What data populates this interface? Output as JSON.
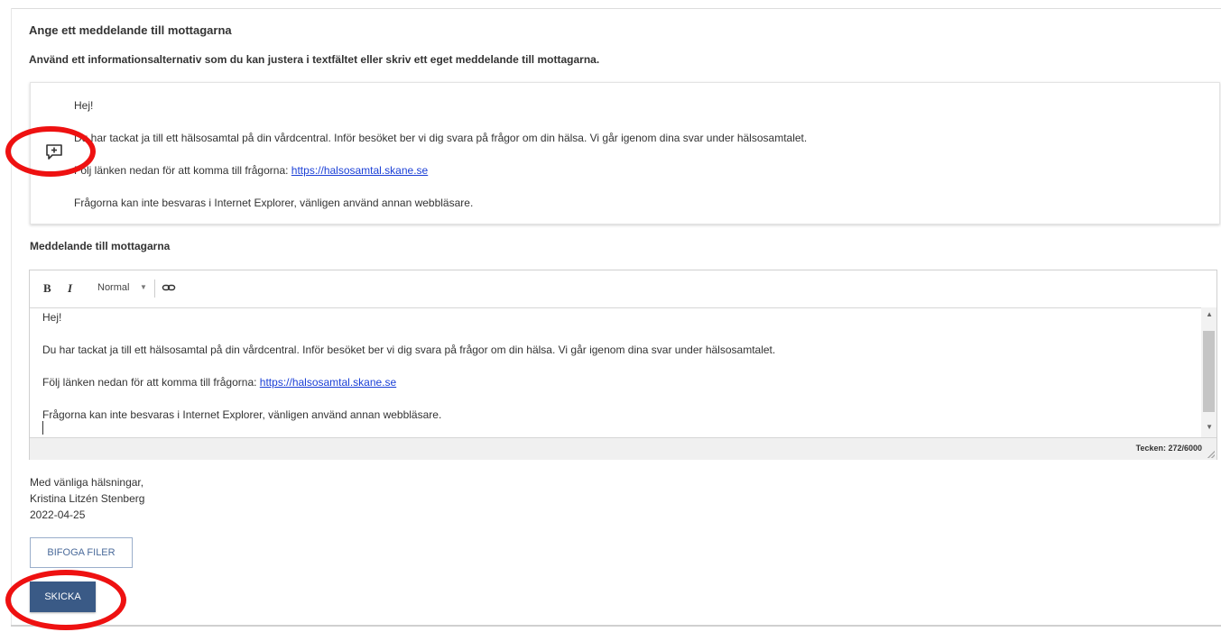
{
  "heading": "Ange ett meddelande till mottagarna",
  "subheading": "Använd ett informationsalternativ som du kan justera i textfältet eller skriv ett eget meddelande till mottagarna.",
  "info_card": {
    "line1": "Hej!",
    "line2": "Du har tackat ja till ett hälsosamtal på din vårdcentral. Inför besöket ber vi dig svara på frågor om din hälsa. Vi går igenom dina svar under hälsosamtalet.",
    "line3_prefix": "Följ länken nedan för att komma till frågorna: ",
    "line3_link": "https://halsosamtal.skane.se",
    "line4": "Frågorna kan inte besvaras i Internet Explorer, vänligen använd annan webbläsare.",
    "icon": "comment-plus-icon"
  },
  "message_label": "Meddelande till mottagarna",
  "toolbar": {
    "bold": "B",
    "italic": "I",
    "format_select": "Normal",
    "icons": [
      "bold-icon",
      "italic-icon",
      "chevron-down-icon",
      "link-icon"
    ]
  },
  "editor": {
    "line1": "Hej!",
    "line2": "Du har tackat ja till ett hälsosamtal på din vårdcentral. Inför besöket ber vi dig svara på frågor om din hälsa. Vi går igenom dina svar under hälsosamtalet.",
    "line3_prefix": "Följ länken nedan för att komma till frågorna: ",
    "line3_link": "https://halsosamtal.skane.se",
    "line4": "Frågorna kan inte besvaras i Internet Explorer, vänligen använd annan webbläsare."
  },
  "counter": "Tecken: 272/6000",
  "signature": {
    "greeting": "Med vänliga hälsningar,",
    "name": "Kristina Litzén Stenberg",
    "date": "2022-04-25"
  },
  "buttons": {
    "attach": "BIFOGA FILER",
    "send": "SKICKA"
  },
  "colors": {
    "primary": "#3a5a86",
    "link": "#1a3fd6",
    "highlight": "#ee1111"
  }
}
